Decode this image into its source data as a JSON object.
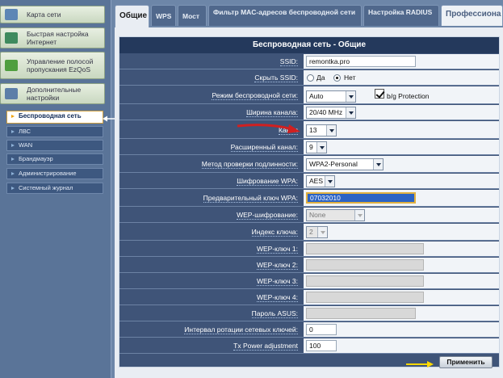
{
  "sidebar": {
    "top_items": [
      {
        "label": "Карта сети",
        "icon": "network-map-icon"
      },
      {
        "label": "Быстрая настройка Интернет",
        "icon": "quick-setup-icon"
      },
      {
        "label": "Управление полосой пропускания EzQoS",
        "icon": "ezqos-icon"
      },
      {
        "label": "Дополнительные настройки",
        "icon": "advanced-settings-icon"
      }
    ],
    "sub_items": [
      "Беспроводная сеть",
      "ЛВС",
      "WAN",
      "Брандмауэр",
      "Администрирование",
      "Системный журнал"
    ]
  },
  "tabs": [
    "Общие",
    "WPS",
    "Мост",
    "Фильтр MAC-адресов беспроводной сети",
    "Настройка RADIUS",
    "Профессиона"
  ],
  "form": {
    "title": "Беспроводная сеть - Общие",
    "labels": {
      "ssid": "SSID:",
      "hide_ssid": "Скрыть SSID:",
      "mode": "Режим беспроводной сети:",
      "bandwidth": "Ширина канала:",
      "channel": "Канал",
      "ext_channel": "Расширенный канал:",
      "auth": "Метод проверки подлинности:",
      "wpa_enc": "Шифрование WPA:",
      "wpa_key": "Предварительный ключ WPA:",
      "wep_enc": "WEP-шифрование:",
      "key_index": "Индекс ключа:",
      "wep1": "WEP-ключ 1:",
      "wep2": "WEP-ключ 2:",
      "wep3": "WEP-ключ 3:",
      "wep4": "WEP-ключ 4:",
      "asus_pass": "Пароль ASUS:",
      "rotation": "Интервал ротации сетевых ключей:",
      "txpower": "Tx Power adjustment"
    },
    "values": {
      "ssid": "remontka.pro",
      "hide_yes": "Да",
      "hide_no": "Нет",
      "mode": "Auto",
      "bg_protection": "b/g Protection",
      "bandwidth": "20/40 MHz",
      "channel": "13",
      "ext_channel": "9",
      "auth": "WPA2-Personal",
      "wpa_enc": "AES",
      "wpa_key": "07032010",
      "wep_enc": "None",
      "key_index": "2",
      "rotation": "0",
      "txpower": "100"
    },
    "apply_label": "Применить"
  },
  "colors": {
    "arrow_red": "#d02020",
    "arrow_yellow": "#ffd800",
    "arrow_white": "#ffffff"
  }
}
